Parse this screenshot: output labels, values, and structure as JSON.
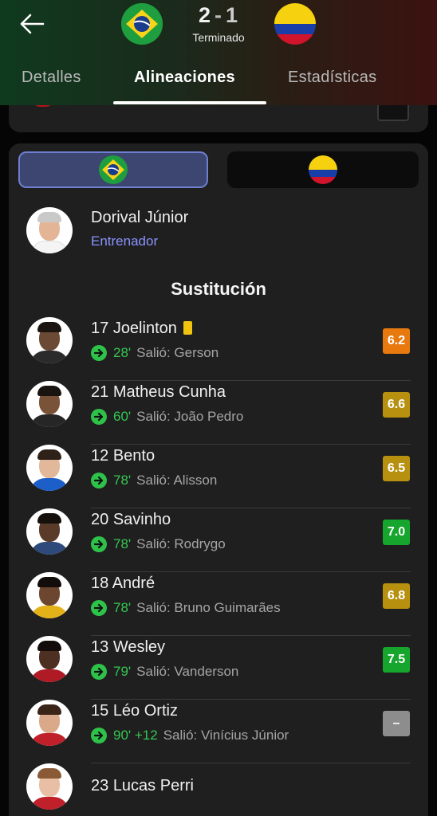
{
  "header": {
    "back_icon": "arrow-left-icon",
    "home_team_flag": "brazil-flag-icon",
    "away_team_flag": "colombia-flag-icon",
    "score_home": "2",
    "score_separator": "-",
    "score_away": "1",
    "status": "Terminado"
  },
  "tabs": [
    {
      "label": "Detalles",
      "active": false
    },
    {
      "label": "Alineaciones",
      "active": true
    },
    {
      "label": "Estadísticas",
      "active": false
    }
  ],
  "coach": {
    "name": "Dorival Júnior",
    "role": "Entrenador"
  },
  "section_title": "Sustitución",
  "colors": {
    "rating_orange": "#e8790f",
    "rating_gold": "#b8900f",
    "rating_green": "#17a62d",
    "rating_gray": "#8d8d8d",
    "accent_purple": "#8a93ff",
    "sub_green": "#35c852"
  },
  "substitutes": [
    {
      "number": "17",
      "name": "Joelinton",
      "yellow_card": true,
      "minute": "28'",
      "out_label": "Salió: Gerson",
      "rating": "6.2",
      "rating_color": "#e8790f"
    },
    {
      "number": "21",
      "name": "Matheus Cunha",
      "yellow_card": false,
      "minute": "60'",
      "out_label": "Salió: João Pedro",
      "rating": "6.6",
      "rating_color": "#b8900f"
    },
    {
      "number": "12",
      "name": "Bento",
      "yellow_card": false,
      "minute": "78'",
      "out_label": "Salió: Alisson",
      "rating": "6.5",
      "rating_color": "#b8900f"
    },
    {
      "number": "20",
      "name": "Savinho",
      "yellow_card": false,
      "minute": "78'",
      "out_label": "Salió: Rodrygo",
      "rating": "7.0",
      "rating_color": "#17a62d"
    },
    {
      "number": "18",
      "name": "André",
      "yellow_card": false,
      "minute": "78'",
      "out_label": "Salió: Bruno Guimarães",
      "rating": "6.8",
      "rating_color": "#b8900f"
    },
    {
      "number": "13",
      "name": "Wesley",
      "yellow_card": false,
      "minute": "79'",
      "out_label": "Salió: Vanderson",
      "rating": "7.5",
      "rating_color": "#17a62d"
    },
    {
      "number": "15",
      "name": "Léo Ortiz",
      "yellow_card": false,
      "minute": "90' +12",
      "out_label": "Salió: Vinícius Júnior",
      "rating": "–",
      "rating_color": "#8d8d8d"
    },
    {
      "number": "23",
      "name": "Lucas Perri",
      "yellow_card": false,
      "minute": "",
      "out_label": "",
      "rating": "",
      "rating_color": ""
    }
  ]
}
